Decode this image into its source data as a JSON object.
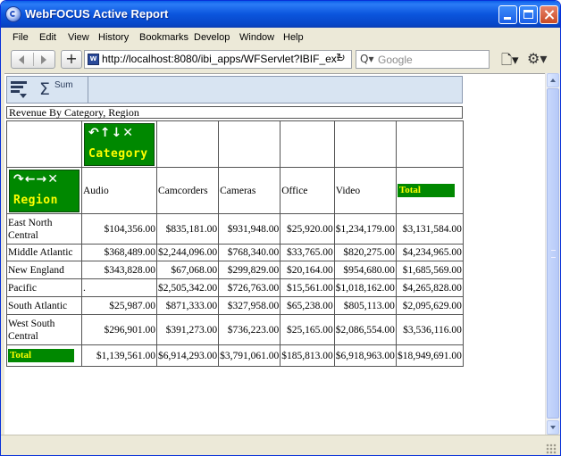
{
  "window": {
    "title": "WebFOCUS Active Report"
  },
  "menu": [
    "File",
    "Edit",
    "View",
    "History",
    "Bookmarks",
    "Develop",
    "Window",
    "Help"
  ],
  "nav": {
    "url": "http://localhost:8080/ibi_apps/WFServlet?IBIF_ex=",
    "search_placeholder": "Google",
    "site_icon_label": "W"
  },
  "report": {
    "toolbar": {
      "sum_label": "Sum"
    },
    "title": "Revenue By Category, Region",
    "column_dimension": {
      "label": "Category",
      "icons": "↶↑↓✕"
    },
    "row_dimension": {
      "label": "Region",
      "icons": "↷←→✕"
    },
    "columns": [
      "Audio",
      "Camcorders",
      "Cameras",
      "Office",
      "Video",
      "Total"
    ],
    "rows": [
      {
        "region": "East North Central",
        "values": [
          "$104,356.00",
          "$835,181.00",
          "$931,948.00",
          "$25,920.00",
          "$1,234,179.00",
          "$3,131,584.00"
        ]
      },
      {
        "region": "Middle Atlantic",
        "values": [
          "$368,489.00",
          "$2,244,096.00",
          "$768,340.00",
          "$33,765.00",
          "$820,275.00",
          "$4,234,965.00"
        ]
      },
      {
        "region": "New England",
        "values": [
          "$343,828.00",
          "$67,068.00",
          "$299,829.00",
          "$20,164.00",
          "$954,680.00",
          "$1,685,569.00"
        ]
      },
      {
        "region": "Pacific",
        "values": [
          ".",
          "$2,505,342.00",
          "$726,763.00",
          "$15,561.00",
          "$1,018,162.00",
          "$4,265,828.00"
        ]
      },
      {
        "region": "South Atlantic",
        "values": [
          "$25,987.00",
          "$871,333.00",
          "$327,958.00",
          "$65,238.00",
          "$805,113.00",
          "$2,095,629.00"
        ]
      },
      {
        "region": "West South Central",
        "values": [
          "$296,901.00",
          "$391,273.00",
          "$736,223.00",
          "$25,165.00",
          "$2,086,554.00",
          "$3,536,116.00"
        ]
      }
    ],
    "total_row": {
      "label": "Total",
      "values": [
        "$1,139,561.00",
        "$6,914,293.00",
        "$3,791,061.00",
        "$185,813.00",
        "$6,918,963.00",
        "$18,949,691.00"
      ]
    }
  },
  "colors": {
    "titlebar": "#0a55dd",
    "dimension_bg": "#008800",
    "dimension_text": "#ffff00",
    "toolbar_bg": "#d8e4f2"
  }
}
